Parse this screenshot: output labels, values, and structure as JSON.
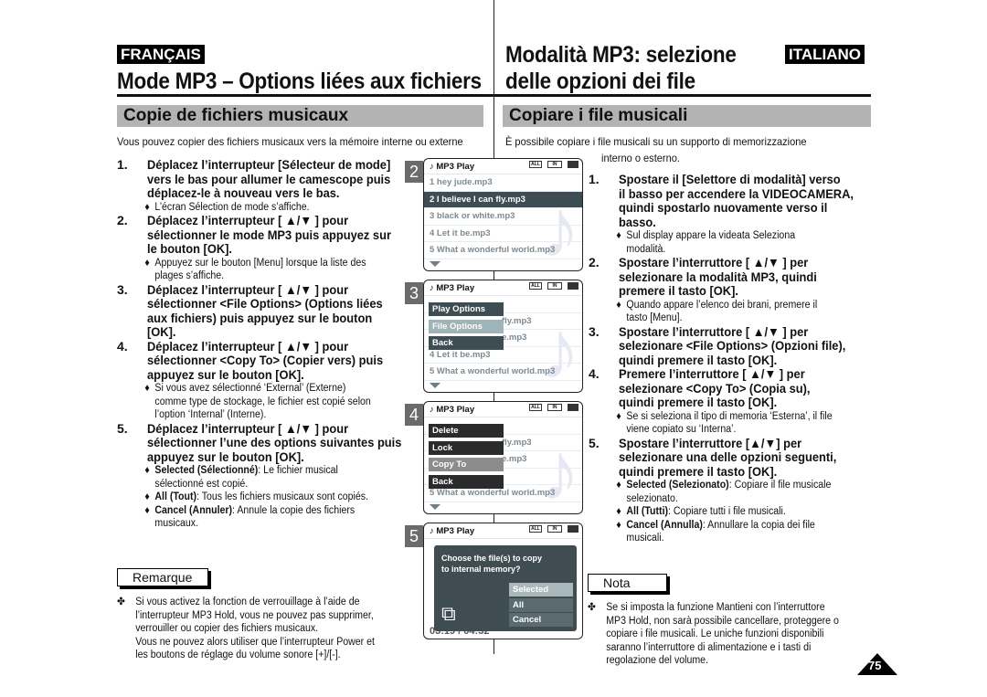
{
  "header": {
    "left_lang": "FRANÇAIS",
    "right_lang": "ITALIANO",
    "left_title": "Mode MP3 – Options liées aux fichiers",
    "right_title_line1": "Modalità MP3: selezione",
    "right_title_line2": "delle opzioni dei file"
  },
  "fr": {
    "section": "Copie de fichiers musicaux",
    "intro": "Vous pouvez copier des fichiers musicaux vers la mémoire interne ou externe",
    "steps": [
      {
        "num": "1.",
        "lines": [
          "Déplacez l’interrupteur [Sélecteur de mode]",
          "vers  le bas pour allumer le camescope puis",
          "déplacez-le à nouveau vers le bas."
        ],
        "bullets": [
          [
            "L’écran Sélection de mode s’affiche."
          ]
        ]
      },
      {
        "num": "2.",
        "lines": [
          "Déplacez l’interrupteur [ ▲/▼ ] pour",
          "sélectionner le mode MP3 puis appuyez sur",
          "le bouton [OK]."
        ],
        "bullets": [
          [
            " Appuyez sur le bouton [Menu] lorsque la liste des",
            "plages s’affiche."
          ]
        ]
      },
      {
        "num": "3.",
        "lines": [
          "Déplacez l’interrupteur [ ▲/▼ ] pour",
          "sélectionner <File Options> (Options liées",
          "aux fichiers) puis appuyez sur le bouton",
          "[OK]."
        ]
      },
      {
        "num": "4.",
        "lines": [
          "Déplacez l’interrupteur [ ▲/▼ ] pour",
          "sélectionner <Copy To> (Copier vers) puis",
          "appuyez sur le bouton [OK]."
        ],
        "bullets": [
          [
            "Si vous avez sélectionné ‘External’ (Externe)",
            "comme type de stockage, le fichier est copié selon",
            "l’option ‘Internal’ (Interne)."
          ]
        ]
      },
      {
        "num": "5.",
        "lines": [
          "Déplacez l’interrupteur [ ▲/▼ ] pour",
          "sélectionner l’une des options suivantes puis",
          "appuyez sur le bouton [OK]."
        ],
        "bullets": [
          {
            "bold": "Selected (Sélectionné)",
            "rest": ": Le fichier musical",
            "line2": "sélectionné est copié."
          },
          {
            "bold": "All (Tout)",
            "rest": ": Tous les fichiers musicaux sont copiés."
          },
          {
            "bold": "Cancel (Annuler)",
            "rest": ": Annule la copie des fichiers",
            "line2": "musicaux."
          }
        ]
      }
    ],
    "note_title": "Remarque",
    "note_lines": [
      "Si vous activez la fonction de verrouillage à l’aide de",
      "l’interrupteur MP3 Hold, vous ne pouvez pas supprimer,",
      "verrouiller ou copier des fichiers musicaux.",
      "Vous ne pouvez alors utiliser que l’interrupteur Power et",
      "les boutons de réglage du volume sonore [+]/[-]."
    ]
  },
  "it": {
    "section": "Copiare i file musicali",
    "intro_line1": "È possibile copiare i file musicali su un supporto di memorizzazione",
    "intro_line2": "interno o esterno.",
    "steps": [
      {
        "num": "1.",
        "lines": [
          "Spostare il [Selettore di modalità] verso",
          "il basso per accendere la VIDEOCAMERA,",
          "quindi spostarlo nuovamente verso il",
          "basso."
        ],
        "bullets": [
          [
            "Sul display appare la videata Seleziona",
            "modalità."
          ]
        ]
      },
      {
        "num": "2.",
        "lines": [
          "Spostare l’interruttore [ ▲/▼ ] per",
          "selezionare la modalità MP3, quindi",
          "premere il tasto [OK]."
        ],
        "bullets": [
          [
            "Quando appare l’elenco dei brani, premere il",
            "tasto [Menu]."
          ]
        ]
      },
      {
        "num": "3.",
        "lines": [
          "Spostare l’interruttore [ ▲/▼ ] per",
          "selezionare <File Options> (Opzioni file),",
          "quindi premere il tasto [OK]."
        ]
      },
      {
        "num": "4.",
        "lines": [
          "Premere l’interruttore [ ▲/▼ ] per",
          "selezionare <Copy To> (Copia su),",
          "quindi premere il tasto [OK]."
        ],
        "bullets": [
          [
            "Se si seleziona il tipo di memoria ‘Esterna’, il file",
            "viene copiato su ‘Interna’."
          ]
        ]
      },
      {
        "num": "5.",
        "lines": [
          "Spostare l’interruttore [▲/▼] per",
          "selezionare una delle opzioni seguenti,",
          "quindi premere il tasto [OK]."
        ],
        "bullets": [
          {
            "bold": "Selected (Selezionato)",
            "rest": ": Copiare il file musicale",
            "line2": "selezionato."
          },
          {
            "bold": "All (Tutti)",
            "rest": ": Copiare tutti i file musicali."
          },
          {
            "bold": "Cancel (Annulla)",
            "rest": ": Annullare la copia dei file",
            "line2": "musicali."
          }
        ]
      }
    ],
    "note_title": "Nota",
    "note_lines": [
      "Se si imposta la funzione Mantieni con l’interruttore",
      "MP3 Hold, non sarà possibile cancellare, proteggere o",
      "copiare i file musicali. Le uniche funzioni disponibili",
      "saranno l’interruttore di alimentazione e i tasti di",
      "regolazione del volume."
    ]
  },
  "screens": {
    "title": "MP3 Play",
    "icons": {
      "note": "music-note-icon",
      "repeat": "repeat-all-icon",
      "memory": "internal-memory-icon",
      "battery": "battery-icon"
    },
    "repeat_label": "ALL",
    "memory_label": "IN",
    "tracks": [
      "1  hey jude.mp3",
      "2  I believe I can fly.mp3",
      "3  black or white.mp3",
      "4  Let it be.mp3",
      "5  What a wonderful world.mp3"
    ],
    "s2": {
      "badge": "2",
      "selected_index": 1
    },
    "s3": {
      "badge": "3",
      "menu": [
        "Play Options",
        "File Options",
        "Back"
      ],
      "selected_index": 1,
      "visible_tails": [
        "",
        "fly.mp3",
        "e.mp3"
      ]
    },
    "s4": {
      "badge": "4",
      "menu": [
        "Delete",
        "Lock",
        "Copy To",
        "Back"
      ],
      "selected_index": 2,
      "visible_tails": [
        "fly.mp3",
        "e.mp3"
      ]
    },
    "s5": {
      "badge": "5",
      "dialog_line1": "Choose the file(s) to copy",
      "dialog_line2": "to internal memory?",
      "options": [
        "Selected",
        "All",
        "Cancel"
      ],
      "selected_index": 0,
      "time": "03:19 / 04:32"
    }
  },
  "page_number": "75",
  "colors": {
    "menu_dark": "#3e4c53",
    "menu_sel3": "#9fb4b8",
    "menu4": "#2b2b2b",
    "menu_sel4": "#8c8c8c",
    "dialog": "#3f4c52",
    "opt": "#5a6b70",
    "opt_sel": "#a9b9bb",
    "section_bar": "#b3b3b3"
  }
}
